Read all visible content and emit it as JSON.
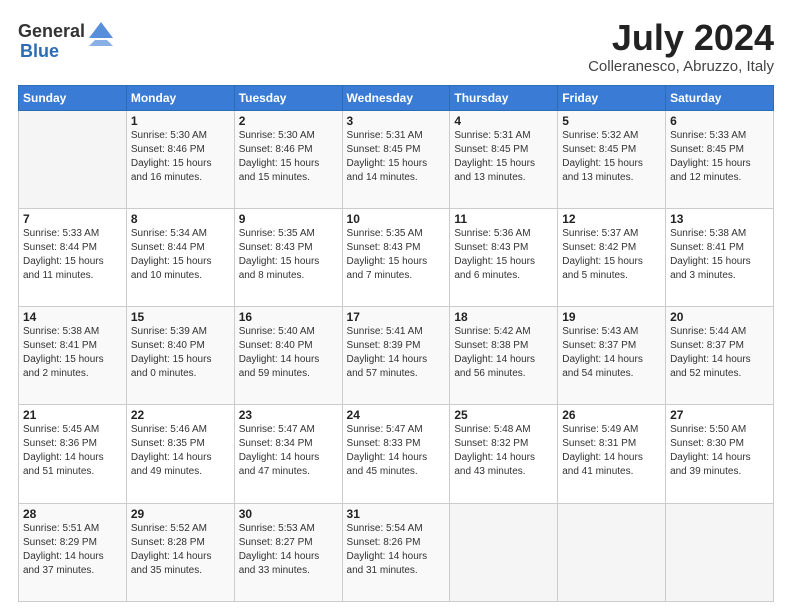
{
  "header": {
    "logo_general": "General",
    "logo_blue": "Blue",
    "title": "July 2024",
    "location": "Colleranesco, Abruzzo, Italy"
  },
  "calendar": {
    "days_of_week": [
      "Sunday",
      "Monday",
      "Tuesday",
      "Wednesday",
      "Thursday",
      "Friday",
      "Saturday"
    ],
    "weeks": [
      [
        {
          "day": "",
          "info": ""
        },
        {
          "day": "1",
          "info": "Sunrise: 5:30 AM\nSunset: 8:46 PM\nDaylight: 15 hours\nand 16 minutes."
        },
        {
          "day": "2",
          "info": "Sunrise: 5:30 AM\nSunset: 8:46 PM\nDaylight: 15 hours\nand 15 minutes."
        },
        {
          "day": "3",
          "info": "Sunrise: 5:31 AM\nSunset: 8:45 PM\nDaylight: 15 hours\nand 14 minutes."
        },
        {
          "day": "4",
          "info": "Sunrise: 5:31 AM\nSunset: 8:45 PM\nDaylight: 15 hours\nand 13 minutes."
        },
        {
          "day": "5",
          "info": "Sunrise: 5:32 AM\nSunset: 8:45 PM\nDaylight: 15 hours\nand 13 minutes."
        },
        {
          "day": "6",
          "info": "Sunrise: 5:33 AM\nSunset: 8:45 PM\nDaylight: 15 hours\nand 12 minutes."
        }
      ],
      [
        {
          "day": "7",
          "info": "Sunrise: 5:33 AM\nSunset: 8:44 PM\nDaylight: 15 hours\nand 11 minutes."
        },
        {
          "day": "8",
          "info": "Sunrise: 5:34 AM\nSunset: 8:44 PM\nDaylight: 15 hours\nand 10 minutes."
        },
        {
          "day": "9",
          "info": "Sunrise: 5:35 AM\nSunset: 8:43 PM\nDaylight: 15 hours\nand 8 minutes."
        },
        {
          "day": "10",
          "info": "Sunrise: 5:35 AM\nSunset: 8:43 PM\nDaylight: 15 hours\nand 7 minutes."
        },
        {
          "day": "11",
          "info": "Sunrise: 5:36 AM\nSunset: 8:43 PM\nDaylight: 15 hours\nand 6 minutes."
        },
        {
          "day": "12",
          "info": "Sunrise: 5:37 AM\nSunset: 8:42 PM\nDaylight: 15 hours\nand 5 minutes."
        },
        {
          "day": "13",
          "info": "Sunrise: 5:38 AM\nSunset: 8:41 PM\nDaylight: 15 hours\nand 3 minutes."
        }
      ],
      [
        {
          "day": "14",
          "info": "Sunrise: 5:38 AM\nSunset: 8:41 PM\nDaylight: 15 hours\nand 2 minutes."
        },
        {
          "day": "15",
          "info": "Sunrise: 5:39 AM\nSunset: 8:40 PM\nDaylight: 15 hours\nand 0 minutes."
        },
        {
          "day": "16",
          "info": "Sunrise: 5:40 AM\nSunset: 8:40 PM\nDaylight: 14 hours\nand 59 minutes."
        },
        {
          "day": "17",
          "info": "Sunrise: 5:41 AM\nSunset: 8:39 PM\nDaylight: 14 hours\nand 57 minutes."
        },
        {
          "day": "18",
          "info": "Sunrise: 5:42 AM\nSunset: 8:38 PM\nDaylight: 14 hours\nand 56 minutes."
        },
        {
          "day": "19",
          "info": "Sunrise: 5:43 AM\nSunset: 8:37 PM\nDaylight: 14 hours\nand 54 minutes."
        },
        {
          "day": "20",
          "info": "Sunrise: 5:44 AM\nSunset: 8:37 PM\nDaylight: 14 hours\nand 52 minutes."
        }
      ],
      [
        {
          "day": "21",
          "info": "Sunrise: 5:45 AM\nSunset: 8:36 PM\nDaylight: 14 hours\nand 51 minutes."
        },
        {
          "day": "22",
          "info": "Sunrise: 5:46 AM\nSunset: 8:35 PM\nDaylight: 14 hours\nand 49 minutes."
        },
        {
          "day": "23",
          "info": "Sunrise: 5:47 AM\nSunset: 8:34 PM\nDaylight: 14 hours\nand 47 minutes."
        },
        {
          "day": "24",
          "info": "Sunrise: 5:47 AM\nSunset: 8:33 PM\nDaylight: 14 hours\nand 45 minutes."
        },
        {
          "day": "25",
          "info": "Sunrise: 5:48 AM\nSunset: 8:32 PM\nDaylight: 14 hours\nand 43 minutes."
        },
        {
          "day": "26",
          "info": "Sunrise: 5:49 AM\nSunset: 8:31 PM\nDaylight: 14 hours\nand 41 minutes."
        },
        {
          "day": "27",
          "info": "Sunrise: 5:50 AM\nSunset: 8:30 PM\nDaylight: 14 hours\nand 39 minutes."
        }
      ],
      [
        {
          "day": "28",
          "info": "Sunrise: 5:51 AM\nSunset: 8:29 PM\nDaylight: 14 hours\nand 37 minutes."
        },
        {
          "day": "29",
          "info": "Sunrise: 5:52 AM\nSunset: 8:28 PM\nDaylight: 14 hours\nand 35 minutes."
        },
        {
          "day": "30",
          "info": "Sunrise: 5:53 AM\nSunset: 8:27 PM\nDaylight: 14 hours\nand 33 minutes."
        },
        {
          "day": "31",
          "info": "Sunrise: 5:54 AM\nSunset: 8:26 PM\nDaylight: 14 hours\nand 31 minutes."
        },
        {
          "day": "",
          "info": ""
        },
        {
          "day": "",
          "info": ""
        },
        {
          "day": "",
          "info": ""
        }
      ]
    ]
  }
}
